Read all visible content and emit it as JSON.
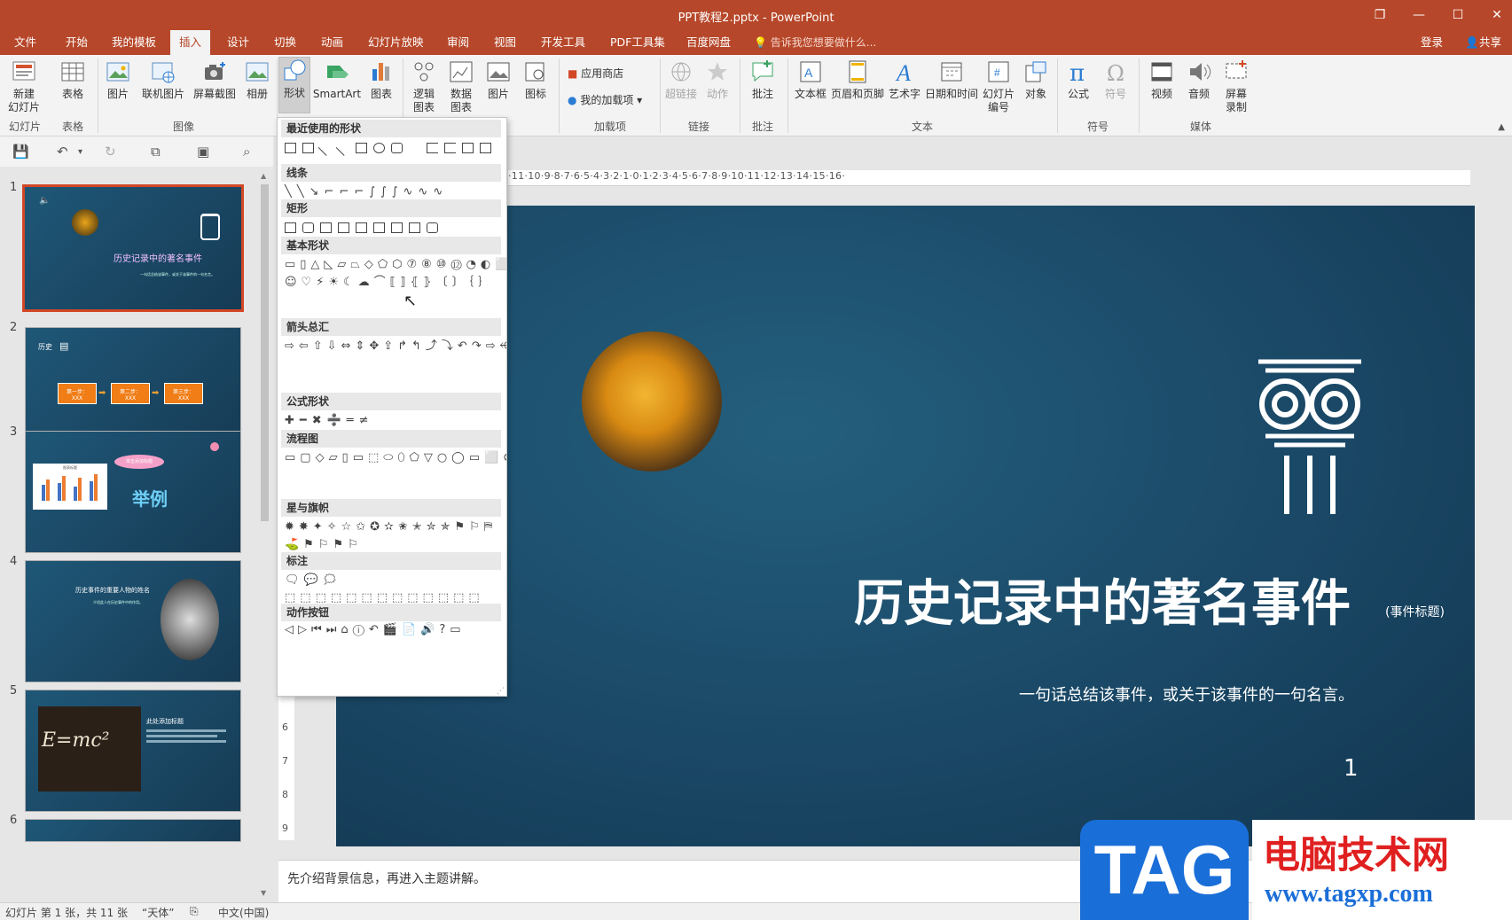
{
  "window": {
    "title": "PPT教程2.pptx - PowerPoint",
    "buttons": [
      "restore-icon",
      "minimize-icon",
      "maximize-icon",
      "close-icon"
    ]
  },
  "tabs": [
    {
      "label": "文件"
    },
    {
      "label": "开始"
    },
    {
      "label": "我的模板"
    },
    {
      "label": "插入",
      "active": true
    },
    {
      "label": "设计"
    },
    {
      "label": "切换"
    },
    {
      "label": "动画"
    },
    {
      "label": "幻灯片放映"
    },
    {
      "label": "审阅"
    },
    {
      "label": "视图"
    },
    {
      "label": "开发工具"
    },
    {
      "label": "PDF工具集"
    },
    {
      "label": "百度网盘"
    }
  ],
  "tellme": "告诉我您想要做什么...",
  "login": "登录",
  "share": "共享",
  "ribbon": {
    "new_slide": "新建\n幻灯片",
    "table": "表格",
    "picture": "图片",
    "online_picture": "联机图片",
    "screenshot": "屏幕截图",
    "album": "相册",
    "shapes": "形状",
    "smartart": "SmartArt",
    "chart": "图表",
    "logic_chart": "逻辑\n图表",
    "data_chart": "数据\n图表",
    "picture2": "图片",
    "icon": "图标",
    "store": "应用商店",
    "my_addins": "我的加载项",
    "hyperlink": "超链接",
    "action": "动作",
    "comment": "批注",
    "textbox": "文本框",
    "header_footer": "页眉和页脚",
    "wordart": "艺术字",
    "datetime": "日期和时间",
    "slide_number": "幻灯片\n编号",
    "object": "对象",
    "equation": "公式",
    "symbol": "符号",
    "video": "视频",
    "audio": "音频",
    "screen_record": "屏幕\n录制",
    "groups": {
      "slides": "幻灯片",
      "tables": "表格",
      "images": "图像",
      "addins": "加载项",
      "links": "链接",
      "comments": "批注",
      "text": "文本",
      "symbols": "符号",
      "media": "媒体"
    }
  },
  "shapes_gallery": {
    "sections": [
      "最近使用的形状",
      "线条",
      "矩形",
      "基本形状",
      "箭头总汇",
      "公式形状",
      "流程图",
      "星与旗帜",
      "标注",
      "动作按钮"
    ]
  },
  "ruler": {
    "horizontal": "·11·10·9·8·7·6·5·4·3·2·1·0·1·2·3·4·5·6·7·8·9·10·11·12·13·14·15·16·",
    "vertical": [
      "6",
      "7",
      "8",
      "9"
    ]
  },
  "thumbnails": [
    {
      "num": "1",
      "title": "历史记录中的著名事件",
      "sub": "一句话总结该事件，或关于该事件的一句名言。"
    },
    {
      "num": "2",
      "title": "历史",
      "steps": [
        "第一步：",
        "第二步：",
        "第三步："
      ],
      "step_sub": "XXX"
    },
    {
      "num": "3",
      "bubble": "单击添加标题",
      "big": "举例",
      "chart_title": "图表标题"
    },
    {
      "num": "4",
      "title": "历史事件的重要人物的姓名",
      "sub": "介绍此人在历史事件中的作用。"
    },
    {
      "num": "5",
      "title": "此处添加标题",
      "formula": "E=mc²"
    },
    {
      "num": "6"
    }
  ],
  "slide": {
    "title": "历史记录中的著名事件",
    "tag": "(事件标题)",
    "subtitle": "一句话总结该事件，或关于该事件的一句名言。",
    "page_num": "1"
  },
  "notes": "先介绍背景信息，再进入主题讲解。",
  "status": {
    "slide_info": "幻灯片 第 1 张，共 11 张",
    "theme": "“天体”",
    "language": "中文(中国)"
  },
  "watermark": {
    "tag": "TAG",
    "site_name": "电脑技术网",
    "url": "www.tagxp.com"
  },
  "colors": {
    "accent": "#b7472a",
    "slide_bg": "#1a4866",
    "selected_thumb": "#d24726",
    "step_orange": "#f07d15"
  }
}
